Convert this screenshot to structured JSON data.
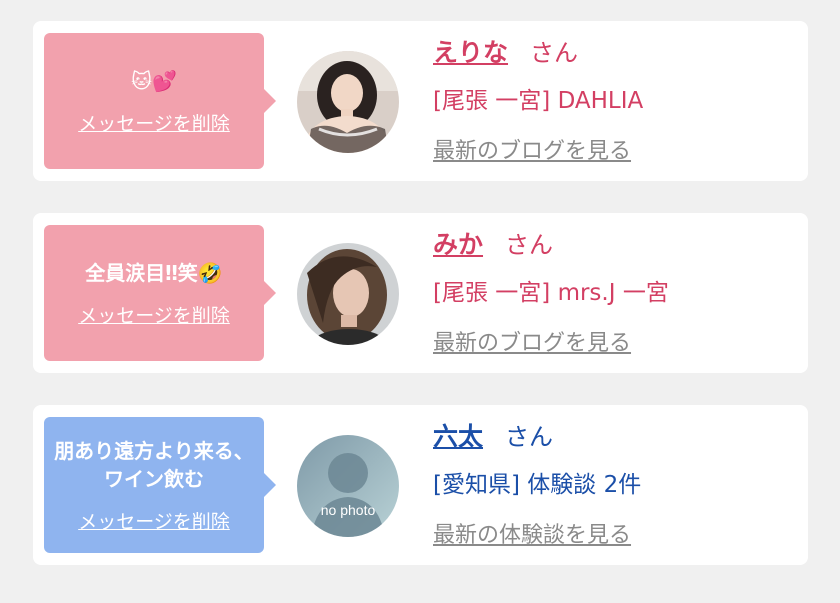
{
  "colors": {
    "pink_text": "#d33f63",
    "blue_text": "#1b4fa8",
    "pink_bubble": "#f2a1ad",
    "blue_bubble": "#8fb4ef",
    "link_gray": "#8a8a8a"
  },
  "cards": [
    {
      "bubble_message": "🐱💕",
      "delete_label": "メッセージを削除",
      "name": "えりな",
      "honorific": "さん",
      "shop": "[尾張 一宮] DAHLIA",
      "more_link": "最新のブログを見る"
    },
    {
      "bubble_message": "全員涙目‼笑🤣",
      "delete_label": "メッセージを削除",
      "name": "みか",
      "honorific": "さん",
      "shop": "[尾張 一宮] mrs.J 一宮",
      "more_link": "最新のブログを見る"
    },
    {
      "bubble_message": "朋あり遠方より来る、ワイン飲む",
      "delete_label": "メッセージを削除",
      "name": "六太",
      "honorific": "さん",
      "shop": "[愛知県] 体験談 2件",
      "more_link": "最新の体験談を見る",
      "avatar_text": "no photo"
    }
  ]
}
